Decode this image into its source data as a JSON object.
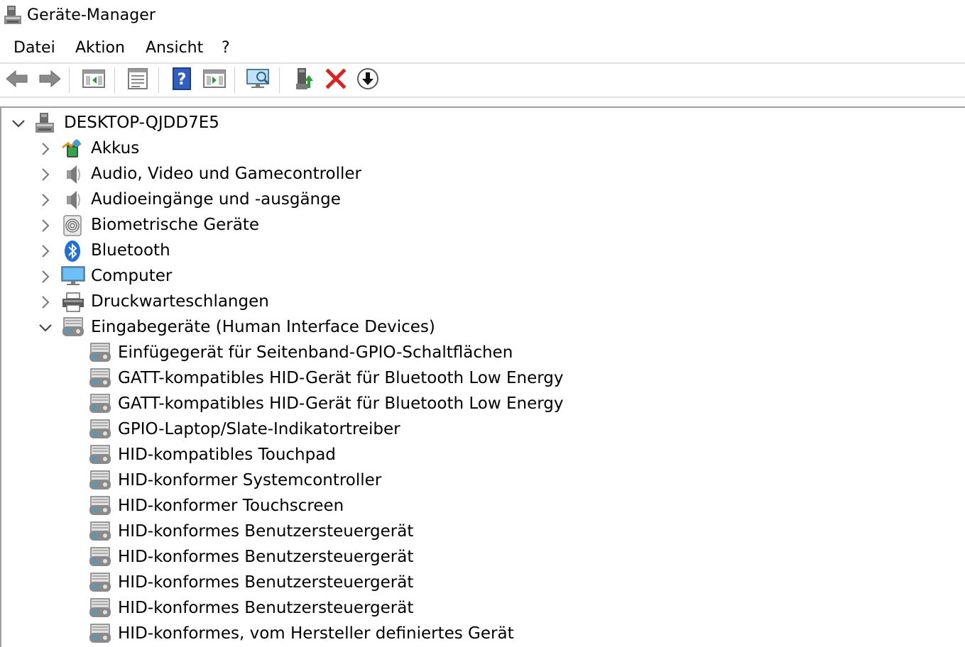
{
  "window": {
    "title": "Geräte-Manager"
  },
  "menu": [
    "Datei",
    "Aktion",
    "Ansicht",
    "?"
  ],
  "toolbar": {
    "buttons": [
      {
        "icon": "back-arrow-icon"
      },
      {
        "icon": "forward-arrow-icon"
      },
      {
        "icon": "show-hide-console-tree-icon"
      },
      {
        "icon": "properties-icon"
      },
      {
        "icon": "help-icon"
      },
      {
        "icon": "show-action-pane-icon"
      },
      {
        "icon": "scan-hardware-changes-icon"
      },
      {
        "icon": "update-driver-icon"
      },
      {
        "icon": "uninstall-device-icon"
      },
      {
        "icon": "download-icon"
      }
    ]
  },
  "tree": {
    "root": {
      "label": "DESKTOP-QJDD7E5",
      "expanded": true,
      "icon": "computer-tower-icon"
    },
    "categories": [
      {
        "label": "Akkus",
        "icon": "battery-icon",
        "expanded": false
      },
      {
        "label": "Audio, Video und Gamecontroller",
        "icon": "speaker-icon",
        "expanded": false
      },
      {
        "label": "Audioeingänge und -ausgänge",
        "icon": "speaker-icon",
        "expanded": false
      },
      {
        "label": "Biometrische Geräte",
        "icon": "fingerprint-icon",
        "expanded": false
      },
      {
        "label": "Bluetooth",
        "icon": "bluetooth-icon",
        "expanded": false
      },
      {
        "label": "Computer",
        "icon": "monitor-icon",
        "expanded": false
      },
      {
        "label": "Druckwarteschlangen",
        "icon": "printer-icon",
        "expanded": false
      },
      {
        "label": "Eingabegeräte (Human Interface Devices)",
        "icon": "hid-icon",
        "expanded": true
      }
    ],
    "hid_children": [
      "Einfügegerät für Seitenband-GPIO-Schaltflächen",
      "GATT-kompatibles HID-Gerät für Bluetooth Low Energy",
      "GATT-kompatibles HID-Gerät für Bluetooth Low Energy",
      "GPIO-Laptop/Slate-Indikatortreiber",
      "HID-kompatibles Touchpad",
      "HID-konformer Systemcontroller",
      "HID-konformer Touchscreen",
      "HID-konformes Benutzersteuergerät",
      "HID-konformes Benutzersteuergerät",
      "HID-konformes Benutzersteuergerät",
      "HID-konformes Benutzersteuergerät",
      "HID-konformes, vom Hersteller definiertes Gerät"
    ]
  },
  "colors": {
    "accent_blue": "#1e6fd9",
    "delete_red": "#e02020",
    "update_green": "#1ea12e"
  }
}
